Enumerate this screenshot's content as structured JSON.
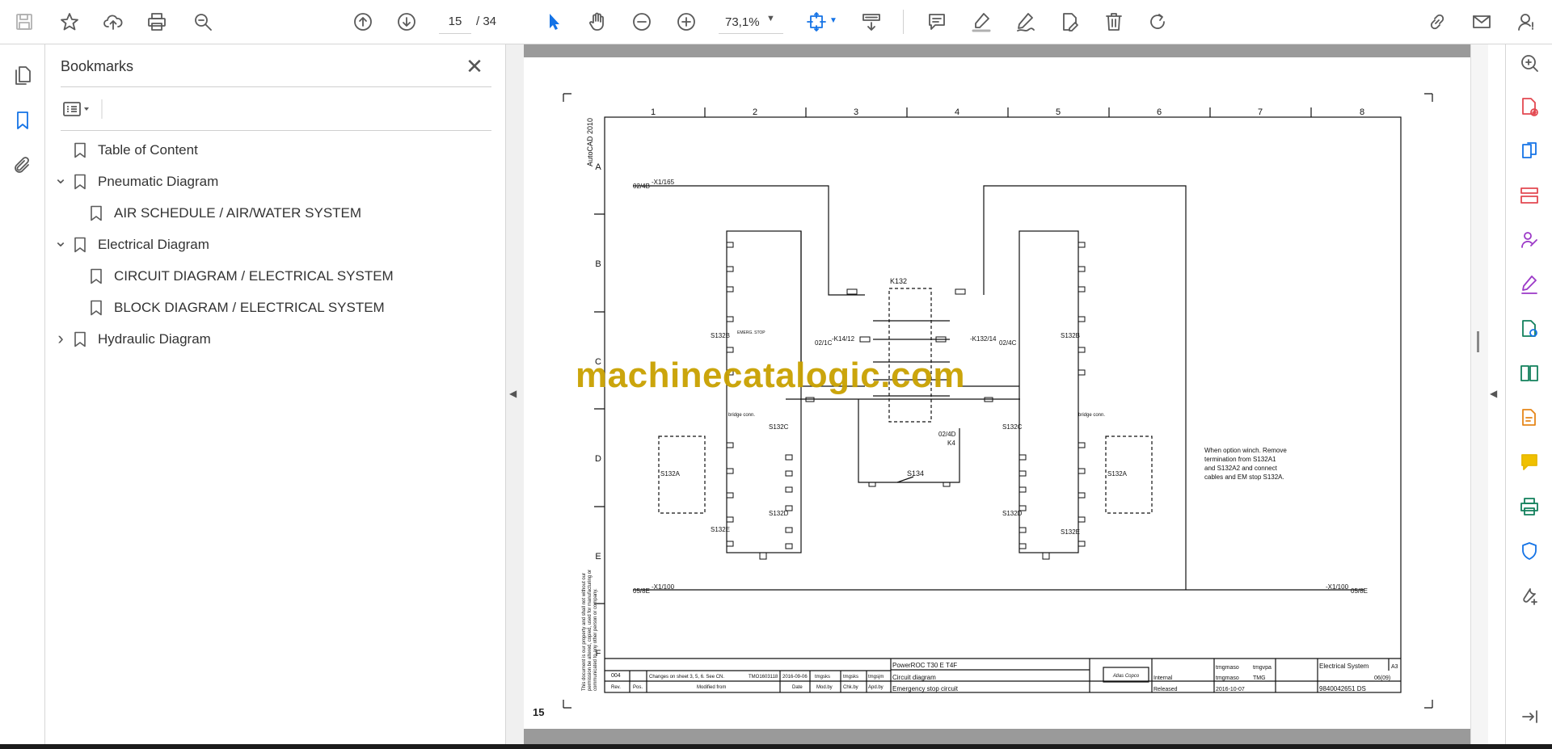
{
  "toolbar": {
    "page_current": "15",
    "page_total": "/ 34",
    "zoom": "73,1%"
  },
  "bookmarks": {
    "title": "Bookmarks",
    "items": [
      {
        "label": "Table of Content",
        "level": 0,
        "expander": ""
      },
      {
        "label": "Pneumatic Diagram",
        "level": 0,
        "expander": "expanded"
      },
      {
        "label": "AIR SCHEDULE / AIR/WATER SYSTEM",
        "level": 1,
        "expander": ""
      },
      {
        "label": "Electrical Diagram",
        "level": 0,
        "expander": "expanded"
      },
      {
        "label": "CIRCUIT DIAGRAM / ELECTRICAL SYSTEM",
        "level": 1,
        "expander": ""
      },
      {
        "label": "BLOCK DIAGRAM / ELECTRICAL SYSTEM",
        "level": 1,
        "expander": ""
      },
      {
        "label": "Hydraulic Diagram",
        "level": 0,
        "expander": "collapsed"
      }
    ]
  },
  "document": {
    "page_number": "15",
    "watermark": "machinecatalogic.com",
    "autocad_label": "AutoCAD 2010",
    "columns": [
      "1",
      "2",
      "3",
      "4",
      "5",
      "6",
      "7",
      "8"
    ],
    "rows": [
      "A",
      "B",
      "C",
      "D",
      "E",
      "F"
    ],
    "refs": {
      "x1_165": "-X1/165",
      "x1_165_src": "02/4B",
      "x1_100_left": "-X1/100",
      "x1_100_left_src": "05/8E",
      "x1_100_right": "-X1/100",
      "x1_100_right_dst": "05/8E",
      "k132": "K132",
      "k14_12": "-K14/12",
      "k14_src": "02/1C",
      "k132_14": "-K132/14",
      "k132_dst": "02/4C",
      "s134": "S134",
      "ref_0240": "02/4D",
      "ref_k4": "K4"
    },
    "labels": {
      "s132b_left": "S132B",
      "s132c_left": "S132C",
      "s132d_left": "S132D",
      "s132e_left": "S132E",
      "s132a_left": "S132A",
      "s132b_right": "S132B",
      "s132c_right": "S132C",
      "s132d_right": "S132D",
      "s132e_right": "S132E",
      "s132a_right": "S132A",
      "bridge_left": "bridge conn.",
      "bridge_right": "bridge conn.",
      "estop": "EMERG. STOP"
    },
    "note": [
      "When option winch. Remove",
      "termination from S132A1",
      "and S132A2 and connect",
      "cables and EM stop S132A."
    ],
    "side_note": [
      "This document is our property and shall not without our",
      "permission be altered, copied, used for manufacturing or",
      "communicated to any other person or company."
    ],
    "title_block": {
      "rev": "004",
      "change": "Changes on sheet 3, 5, 6. See CN.",
      "cn": "TMO1603118",
      "date": "2016-09-06",
      "by1": "tmgsks",
      "by2": "tmgsks",
      "by3": "tmgsjm",
      "h_rev": "Rev.",
      "h_pos": "Pos.",
      "h_modified": "Modified from",
      "h_date": "Date",
      "h_modby": "Mod.by",
      "h_chkby": "Chk.by",
      "h_apdby": "Apd.by",
      "product": "PowerROC T30 E T4F",
      "doc_type": "Circuit diagram",
      "description": "Emergency stop circuit",
      "logo": "Atlas Copco",
      "confidentiality": "Internal",
      "status": "Released",
      "drawn": "tmgmaso",
      "design": "tmgmaso",
      "approver": "tmgvpa",
      "owner": "TMG",
      "date2": "2016-10-07",
      "designation": "Electrical System",
      "size": "A3",
      "sheet": "06(09)",
      "doc_no": "9840042651 DS"
    }
  }
}
